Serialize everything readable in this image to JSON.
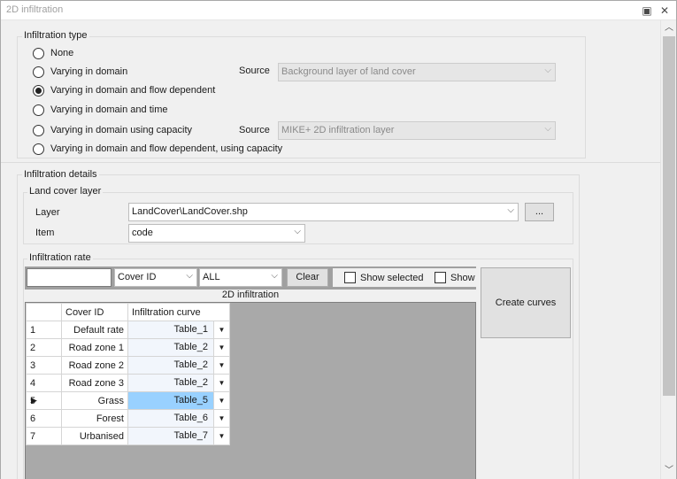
{
  "window": {
    "title": "2D infiltration",
    "restore_glyph": "▣",
    "close_glyph": "✕"
  },
  "infiltration_type": {
    "title": "Infiltration type",
    "options": [
      {
        "label": "None",
        "checked": false
      },
      {
        "label": "Varying in domain",
        "checked": false
      },
      {
        "label": "Varying in domain and flow dependent",
        "checked": true
      },
      {
        "label": "Varying in domain and time",
        "checked": false
      },
      {
        "label": "Varying in domain using capacity",
        "checked": false
      },
      {
        "label": "Varying in domain and flow dependent, using capacity",
        "checked": false
      }
    ],
    "source_label_1": "Source",
    "source_value_1": "Background layer of land cover",
    "source_label_2": "Source",
    "source_value_2": "MIKE+ 2D infiltration layer"
  },
  "infiltration_details": {
    "title": "Infiltration details",
    "land_cover": {
      "title": "Land cover layer",
      "layer_label": "Layer",
      "layer_value": "LandCover\\LandCover.shp",
      "browse_label": "...",
      "item_label": "Item",
      "item_value": "code"
    },
    "rate": {
      "title": "Infiltration rate",
      "filter_value": "",
      "filter_field": "Cover ID",
      "filter_scope": "ALL",
      "clear_label": "Clear",
      "show_selected_label": "Show selected",
      "show_label": "Show",
      "create_curves_label": "Create curves",
      "grid_caption": "2D infiltration",
      "columns": [
        "Cover ID",
        "Infiltration curve"
      ],
      "rows": [
        {
          "n": "1",
          "cover": "Default rate",
          "curve": "Table_1"
        },
        {
          "n": "2",
          "cover": "Road zone 1",
          "curve": "Table_2"
        },
        {
          "n": "3",
          "cover": "Road zone 2",
          "curve": "Table_2"
        },
        {
          "n": "4",
          "cover": "Road zone 3",
          "curve": "Table_2"
        },
        {
          "n": "5",
          "cover": "Grass",
          "curve": "Table_5",
          "selected": true
        },
        {
          "n": "6",
          "cover": "Forest",
          "curve": "Table_6"
        },
        {
          "n": "7",
          "cover": "Urbanised",
          "curve": "Table_7"
        }
      ]
    }
  },
  "icons": {
    "chevron": "⌵",
    "dropdown": "▼",
    "row_pointer": "▶",
    "scroll_up": "︿",
    "scroll_down": "﹀"
  }
}
